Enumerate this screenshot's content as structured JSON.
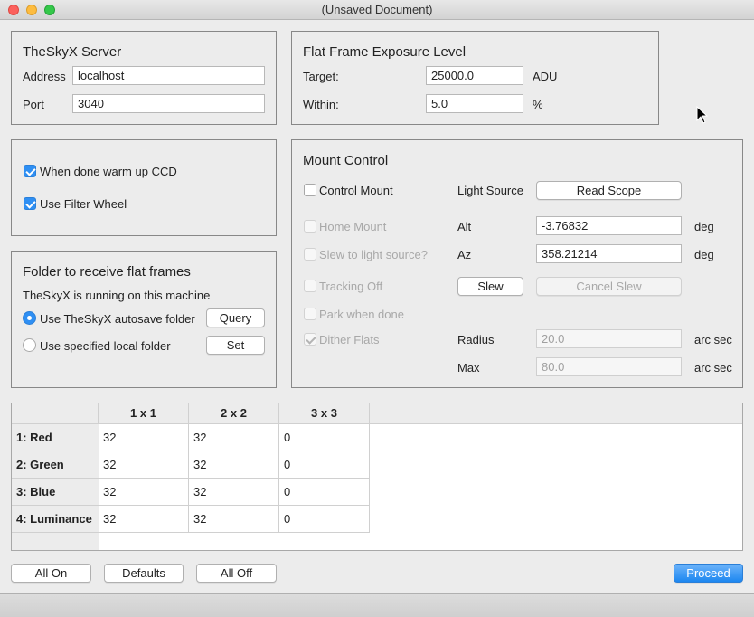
{
  "window": {
    "title": "(Unsaved Document)"
  },
  "server": {
    "heading": "TheSkyX Server",
    "address_label": "Address",
    "address_value": "localhost",
    "port_label": "Port",
    "port_value": "3040"
  },
  "exposure": {
    "heading": "Flat Frame Exposure Level",
    "target_label": "Target:",
    "target_value": "25000.0",
    "target_unit": "ADU",
    "within_label": "Within:",
    "within_value": "5.0",
    "within_unit": "%"
  },
  "options": {
    "warm_up_label": "When done warm up CCD",
    "warm_up_checked": true,
    "filter_wheel_label": "Use Filter Wheel",
    "filter_wheel_checked": true
  },
  "folder": {
    "heading": "Folder to receive flat frames",
    "info": "TheSkyX is running on this machine",
    "autosave_label": "Use TheSkyX autosave folder",
    "query_button": "Query",
    "local_label": "Use specified local folder",
    "set_button": "Set",
    "selected": "autosave"
  },
  "mount": {
    "heading": "Mount Control",
    "control_mount_label": "Control Mount",
    "light_source_label": "Light Source",
    "read_scope_button": "Read Scope",
    "home_mount_label": "Home Mount",
    "alt_label": "Alt",
    "alt_value": "-3.76832",
    "alt_unit": "deg",
    "slew_light_label": "Slew to light source?",
    "az_label": "Az",
    "az_value": "358.21214",
    "az_unit": "deg",
    "tracking_off_label": "Tracking Off",
    "slew_button": "Slew",
    "cancel_slew_button": "Cancel Slew",
    "park_label": "Park when done",
    "dither_label": "Dither Flats",
    "radius_label": "Radius",
    "radius_value": "20.0",
    "radius_unit": "arc sec",
    "max_label": "Max",
    "max_value": "80.0",
    "max_unit": "arc sec"
  },
  "frames_table": {
    "columns": [
      "1 x 1",
      "2 x 2",
      "3 x 3"
    ],
    "rows": [
      {
        "label": "1: Red",
        "values": [
          "32",
          "32",
          "0"
        ]
      },
      {
        "label": "2: Green",
        "values": [
          "32",
          "32",
          "0"
        ]
      },
      {
        "label": "3: Blue",
        "values": [
          "32",
          "32",
          "0"
        ]
      },
      {
        "label": "4: Luminance",
        "values": [
          "32",
          "32",
          "0"
        ]
      }
    ]
  },
  "footer": {
    "all_on": "All On",
    "defaults": "Defaults",
    "all_off": "All Off",
    "proceed": "Proceed"
  },
  "colors": {
    "accent": "#2f8ff3",
    "primary_button": "#1d87f0"
  }
}
